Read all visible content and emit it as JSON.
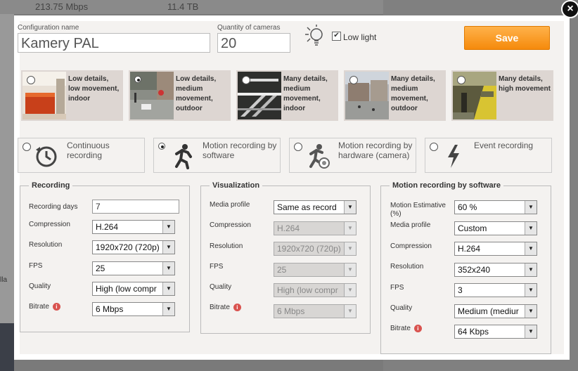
{
  "background": {
    "stat1": "213.75 Mbps",
    "stat2": "11.4 TB",
    "side_text": "lla"
  },
  "header": {
    "config_name_label": "Configuration name",
    "config_name_value": "Kamery PAL",
    "quantity_label": "Quantity of cameras",
    "quantity_value": "20",
    "low_light_label": "Low light",
    "low_light_checked": true,
    "save_label": "Save"
  },
  "presets": [
    {
      "label": "Low details, low movement, indoor",
      "selected": false
    },
    {
      "label": "Low details, medium movement, outdoor",
      "selected": true
    },
    {
      "label": "Many details, medium movement, indoor",
      "selected": false
    },
    {
      "label": "Many details, medium movement, outdoor",
      "selected": false
    },
    {
      "label": "Many details, high movement",
      "selected": false
    }
  ],
  "modes": [
    {
      "label": "Continuous recording",
      "icon": "clock-icon",
      "selected": false
    },
    {
      "label": "Motion recording by software",
      "icon": "running-man-icon",
      "selected": true
    },
    {
      "label": "Motion recording by hardware (camera)",
      "icon": "running-man-camera-icon",
      "selected": false
    },
    {
      "label": "Event recording",
      "icon": "lightning-icon",
      "selected": false
    }
  ],
  "recording": {
    "title": "Recording",
    "days_label": "Recording days",
    "days_value": "7",
    "compression_label": "Compression",
    "compression_value": "H.264",
    "resolution_label": "Resolution",
    "resolution_value": "1920x720 (720p)",
    "fps_label": "FPS",
    "fps_value": "25",
    "quality_label": "Quality",
    "quality_value": "High (low compr",
    "bitrate_label": "Bitrate",
    "bitrate_value": "6 Mbps"
  },
  "visualization": {
    "title": "Visualization",
    "media_profile_label": "Media profile",
    "media_profile_value": "Same as record",
    "compression_label": "Compression",
    "compression_value": "H.264",
    "resolution_label": "Resolution",
    "resolution_value": "1920x720 (720p)",
    "fps_label": "FPS",
    "fps_value": "25",
    "quality_label": "Quality",
    "quality_value": "High (low compr",
    "bitrate_label": "Bitrate",
    "bitrate_value": "6 Mbps"
  },
  "motion": {
    "title": "Motion recording by software",
    "estimative_label": "Motion Estimative (%)",
    "estimative_value": "60 %",
    "media_profile_label": "Media profile",
    "media_profile_value": "Custom",
    "compression_label": "Compression",
    "compression_value": "H.264",
    "resolution_label": "Resolution",
    "resolution_value": "352x240",
    "fps_label": "FPS",
    "fps_value": "3",
    "quality_label": "Quality",
    "quality_value": "Medium (mediur",
    "bitrate_label": "Bitrate",
    "bitrate_value": "64 Kbps"
  },
  "colors": {
    "accent": "#f58a0c",
    "panel": "#f4f2f0",
    "info": "#d9534f"
  }
}
